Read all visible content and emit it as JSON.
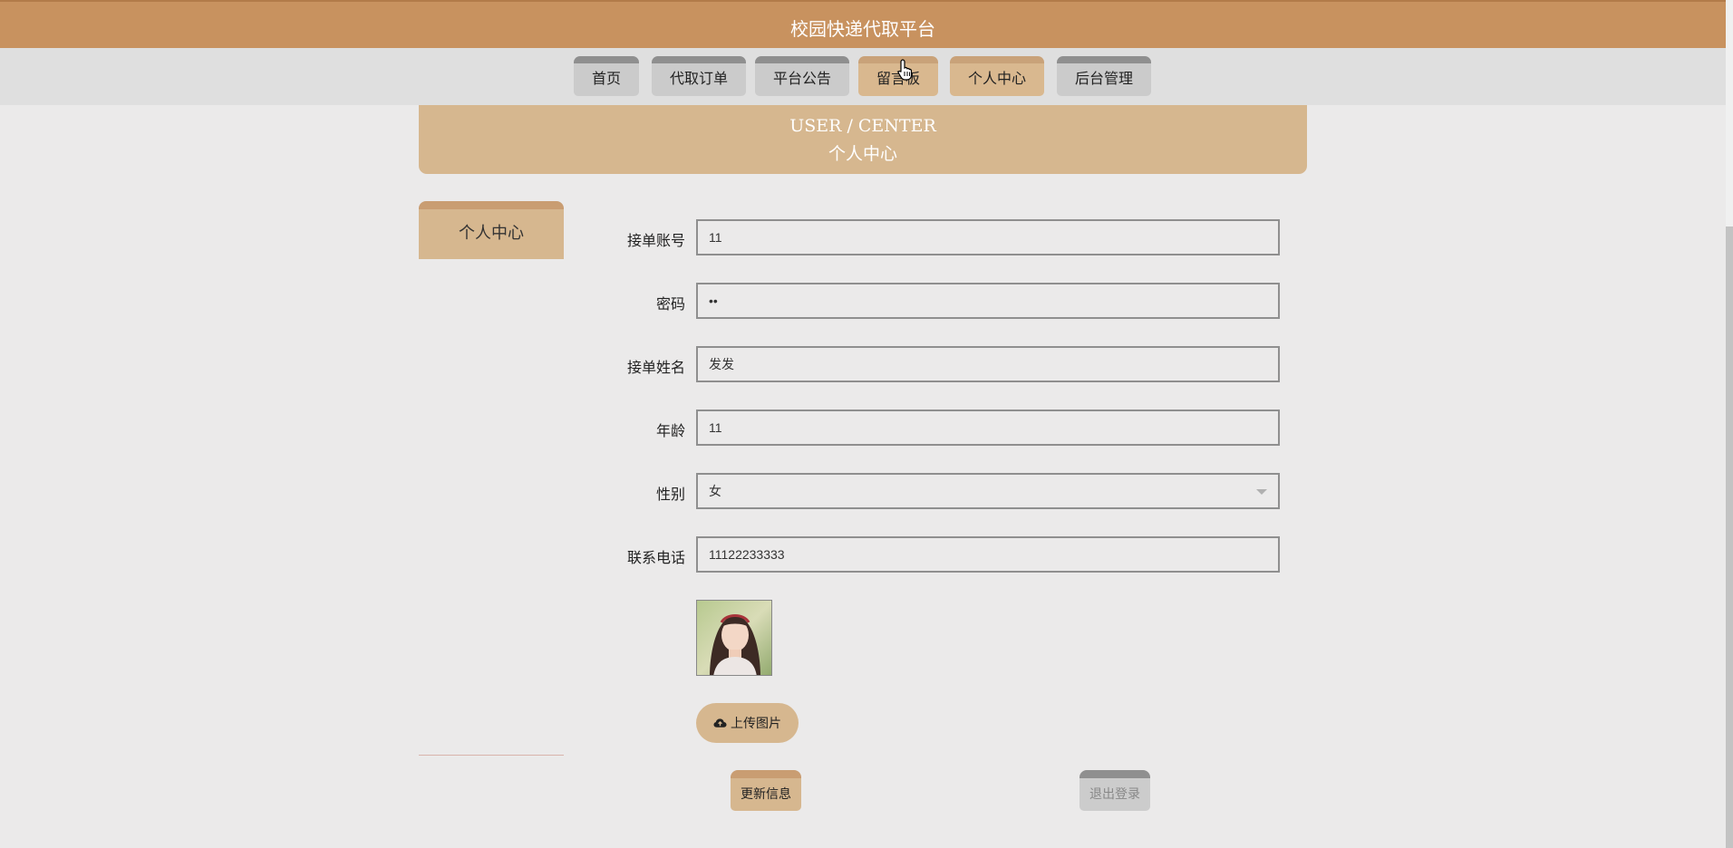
{
  "header": {
    "title": "校园快递代取平台"
  },
  "nav": {
    "items": [
      {
        "label": "首页"
      },
      {
        "label": "代取订单"
      },
      {
        "label": "平台公告"
      },
      {
        "label": "留言板"
      },
      {
        "label": "个人中心"
      },
      {
        "label": "后台管理"
      }
    ]
  },
  "banner": {
    "en": "USER / CENTER",
    "cn": "个人中心"
  },
  "sidebar": {
    "tab": "个人中心"
  },
  "form": {
    "account": {
      "label": "接单账号",
      "value": "11"
    },
    "password": {
      "label": "密码",
      "value": "••"
    },
    "name": {
      "label": "接单姓名",
      "value": "发发"
    },
    "age": {
      "label": "年龄",
      "value": "11"
    },
    "gender": {
      "label": "性别",
      "value": "女"
    },
    "phone": {
      "label": "联系电话",
      "value": "11122233333"
    }
  },
  "upload": {
    "label": "上传图片",
    "icon": "cloud-upload-icon"
  },
  "buttons": {
    "update": "更新信息",
    "logout": "退出登录"
  },
  "colors": {
    "primary": "#c8925f",
    "accent": "#d6b78f",
    "background": "#ebeaea"
  }
}
